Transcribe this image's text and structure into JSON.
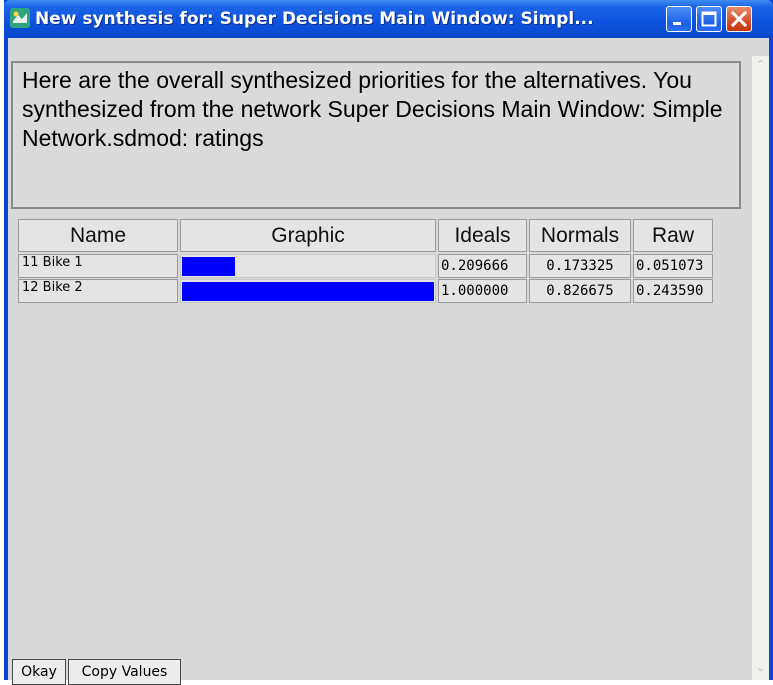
{
  "window": {
    "title": "New synthesis for: Super Decisions Main Window: Simpl...",
    "controls": [
      "minimize-icon",
      "maximize-icon",
      "close-icon"
    ]
  },
  "message": "Here are the overall synthesized priorities for the alternatives.  You synthesized from the network Super Decisions Main Window: Simple Network.sdmod: ratings",
  "table": {
    "headers": [
      "Name",
      "Graphic",
      "Ideals",
      "Normals",
      "Raw"
    ],
    "rows": [
      {
        "name": "11 Bike 1",
        "ideal_value": 0.209666,
        "ideals": "0.209666",
        "normals": "0.173325",
        "raw": "0.051073"
      },
      {
        "name": "12 Bike 2",
        "ideal_value": 1.0,
        "ideals": "1.000000",
        "normals": "0.826675",
        "raw": "0.243590"
      }
    ]
  },
  "buttons": {
    "okay": "Okay",
    "copy_values": "Copy Values"
  },
  "colors": {
    "bar": "#0000ff",
    "titlebar": "#0d52de"
  }
}
